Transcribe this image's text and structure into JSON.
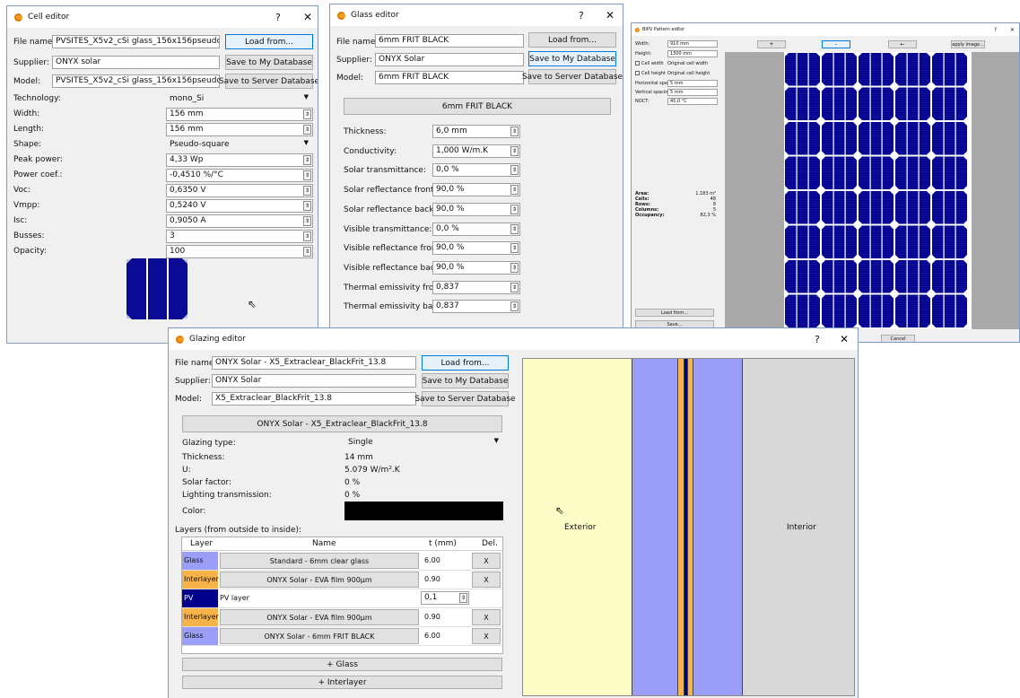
{
  "cell": {
    "title": "Cell editor",
    "help": "?",
    "close": "✕",
    "file_label": "File name:",
    "file_value": "PVSITES_X5v2_cSi glass_156x156pseudo",
    "load": "Load from...",
    "supplier_label": "Supplier:",
    "supplier_value": "ONYX solar",
    "save_my": "Save to My Database",
    "model_label": "Model:",
    "model_value": "PVSITES_X5v2_cSi glass_156x156pseudo",
    "save_server": "Save to Server Database",
    "props": [
      {
        "label": "Technology:",
        "value": "mono_Si"
      },
      {
        "label": "Width:",
        "value": "156 mm"
      },
      {
        "label": "Length:",
        "value": "156 mm"
      },
      {
        "label": "Shape:",
        "value": "Pseudo-square"
      },
      {
        "label": "Peak power:",
        "value": "4,33 Wp"
      },
      {
        "label": "Power coef.:",
        "value": "-0,4510 %/°C"
      },
      {
        "label": "Voc:",
        "value": "0,6350 V"
      },
      {
        "label": "Vmpp:",
        "value": "0,5240 V"
      },
      {
        "label": "Isc:",
        "value": "0,9050 A"
      },
      {
        "label": "Busses:",
        "value": "3"
      },
      {
        "label": "Opacity:",
        "value": "100"
      }
    ]
  },
  "glass": {
    "title": "Glass editor",
    "help": "?",
    "close": "✕",
    "file_label": "File name:",
    "file_value": "6mm FRIT BLACK",
    "load": "Load from...",
    "supplier_label": "Supplier:",
    "supplier_value": "ONYX Solar",
    "save_my": "Save to My Database",
    "model_label": "Model:",
    "model_value": "6mm FRIT BLACK",
    "save_server": "Save to Server Database",
    "name_button": "6mm FRIT BLACK",
    "props": [
      {
        "label": "Thickness:",
        "value": "6,0 mm"
      },
      {
        "label": "Conductivity:",
        "value": "1,000 W/m.K"
      },
      {
        "label": "Solar transmittance:",
        "value": "0,0 %"
      },
      {
        "label": "Solar reflectance front:",
        "value": "90,0 %"
      },
      {
        "label": "Solar reflectance back:",
        "value": "90,0 %"
      },
      {
        "label": "Visible transmittance:",
        "value": "0,0 %"
      },
      {
        "label": "Visible reflectance front:",
        "value": "90,0 %"
      },
      {
        "label": "Visible reflectance back:",
        "value": "90,0 %"
      },
      {
        "label": "Thermal emissivity front:",
        "value": "0,837"
      },
      {
        "label": "Thermal emissivity back:",
        "value": "0,837"
      }
    ]
  },
  "bipv": {
    "title": "BIPV Pattern editor",
    "help": "?",
    "close": "✕",
    "width_label": "Width:",
    "width_value": "910 mm",
    "height_label": "Height:",
    "height_value": "1300 mm",
    "cellwidth_label": "Cell width",
    "cellwidth_value": "Original cell width",
    "cellheight_label": "Cell height",
    "cellheight_value": "Original cell height",
    "hspacing_label": "Horizontal spacing:",
    "hspacing_value": "5 mm",
    "vspacing_label": "Vertical spacing:",
    "vspacing_value": "5 mm",
    "noct_label": "NOCT:",
    "noct_value": "45,0 °C",
    "stats": [
      {
        "label": "Area:",
        "value": "1.183 m²"
      },
      {
        "label": "Cells:",
        "value": "48"
      },
      {
        "label": "Rows:",
        "value": "8"
      },
      {
        "label": "Columns:",
        "value": "5"
      },
      {
        "label": "Occupancy:",
        "value": "82,3 %"
      }
    ],
    "load": "Load from...",
    "save": "Save...",
    "cancel": "Cancel",
    "toolbar": [
      "+",
      "-",
      "←",
      "apply image..."
    ]
  },
  "glazing": {
    "title": "Glazing editor",
    "help": "?",
    "close": "✕",
    "file_label": "File name:",
    "file_value": "ONYX Solar - X5_Extraclear_BlackFrit_13.8",
    "load": "Load from...",
    "supplier_label": "Supplier:",
    "supplier_value": "ONYX Solar",
    "save_my": "Save to My Database",
    "model_label": "Model:",
    "model_value": "X5_Extraclear_BlackFrit_13.8",
    "save_server": "Save to Server Database",
    "name_button": "ONYX Solar - X5_Extraclear_BlackFrit_13.8",
    "type_label": "Glazing type:",
    "type_value": "Single",
    "thickness_label": "Thickness:",
    "thickness_value": "14 mm",
    "u_label": "U:",
    "u_value": "5.079 W/m².K",
    "sf_label": "Solar factor:",
    "sf_value": "0 %",
    "lt_label": "Lighting transmission:",
    "lt_value": "0 %",
    "color_label": "Color:",
    "color_value": "#000000",
    "layers_label": "Layers (from outside to inside):",
    "cols": [
      "Layer",
      "Name",
      "t (mm)",
      "Del."
    ],
    "rows": [
      {
        "type": "Glass",
        "name": "Standard - 6mm clear glass",
        "t": "6.00",
        "del": "X",
        "color": "#9a9ef7"
      },
      {
        "type": "Interlayer",
        "name": "ONYX Solar - EVA film 900µm",
        "t": "0.90",
        "del": "X",
        "color": "#f7b24a"
      },
      {
        "type": "PV",
        "name": "PV layer",
        "t": "0,1",
        "del": "",
        "color": "#00008b"
      },
      {
        "type": "Interlayer",
        "name": "ONYX Solar - EVA film 900µm",
        "t": "0.90",
        "del": "X",
        "color": "#f7b24a"
      },
      {
        "type": "Glass",
        "name": "ONYX Solar - 6mm FRIT BLACK",
        "t": "6.00",
        "del": "X",
        "color": "#9a9ef7"
      }
    ],
    "add_glass": "+ Glass",
    "add_interlayer": "+ Interlayer",
    "exterior": "Exterior",
    "interior": "Interior",
    "colors": {
      "exterior": "#fdfdc8",
      "glass": "#9a9ef7",
      "interlayer": "#f7b24a",
      "pv": "#00008b",
      "interior": "#d8d8d8"
    }
  }
}
